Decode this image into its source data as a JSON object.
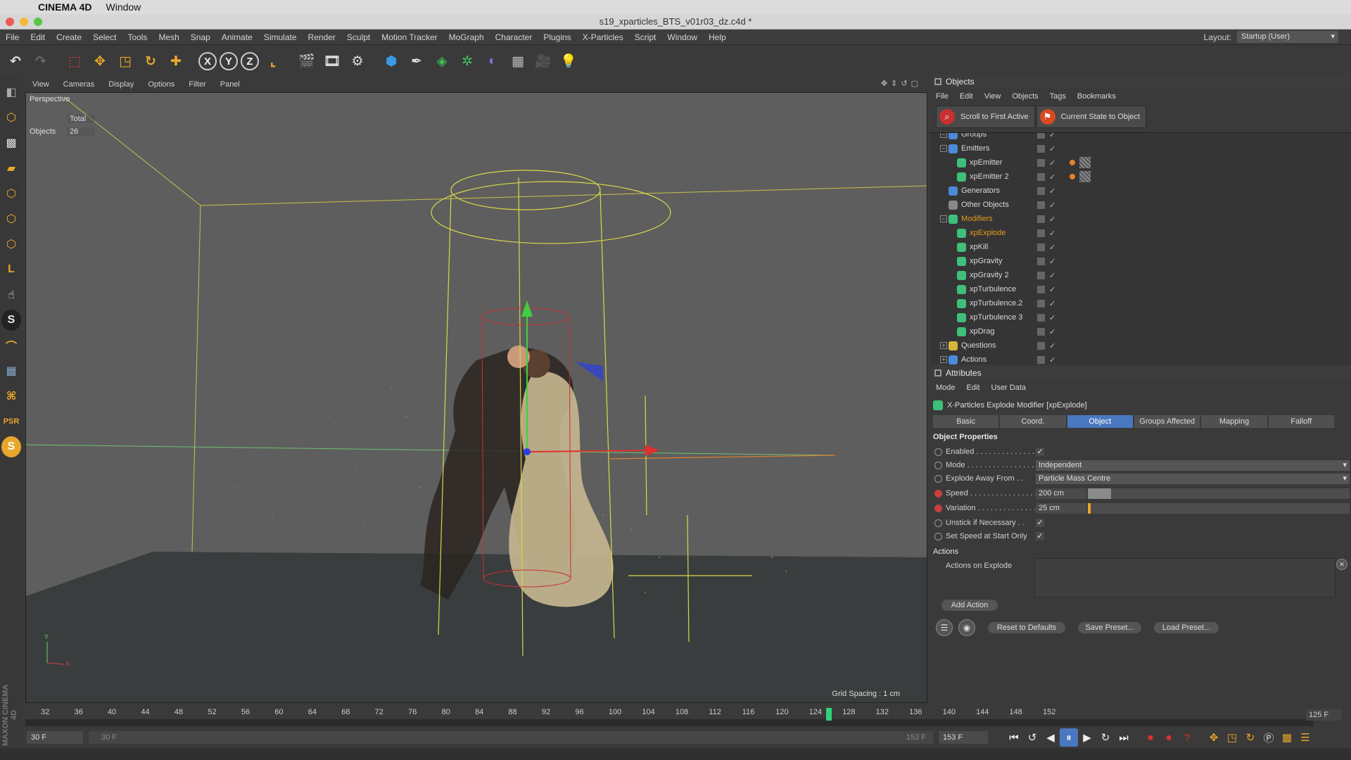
{
  "mac_menu": {
    "app": "CINEMA 4D",
    "items": [
      "Window"
    ]
  },
  "window": {
    "title": "s19_xparticles_BTS_v01r03_dz.c4d *"
  },
  "menu": [
    "File",
    "Edit",
    "Create",
    "Select",
    "Tools",
    "Mesh",
    "Snap",
    "Animate",
    "Simulate",
    "Render",
    "Sculpt",
    "Motion Tracker",
    "MoGraph",
    "Character",
    "Plugins",
    "X-Particles",
    "Script",
    "Window",
    "Help"
  ],
  "layout": {
    "label": "Layout:",
    "value": "Startup (User)"
  },
  "toolbar": {
    "x_label": "X",
    "y_label": "Y",
    "z_label": "Z"
  },
  "viewport": {
    "menu": [
      "View",
      "Cameras",
      "Display",
      "Options",
      "Filter",
      "Panel"
    ],
    "label": "Perspective",
    "hud_total": "Total",
    "hud_objects_label": "Objects",
    "hud_objects_value": "26",
    "grid_spacing": "Grid Spacing : 1 cm",
    "axis_y": "Y",
    "axis_x": "X"
  },
  "timeline": {
    "ticks": [
      "32",
      "36",
      "40",
      "44",
      "48",
      "52",
      "56",
      "60",
      "64",
      "68",
      "72",
      "76",
      "80",
      "84",
      "88",
      "92",
      "96",
      "100",
      "104",
      "108",
      "112",
      "116",
      "120",
      "124",
      "128",
      "132",
      "136",
      "140",
      "144",
      "148",
      "152"
    ],
    "current_frame": 125,
    "first_frame": 32,
    "last_frame": 152,
    "fps_field": "125 F",
    "start_field": "30 F",
    "range_start": "30 F",
    "range_end": "153 F",
    "end_field": "153 F"
  },
  "objects_panel": {
    "title": "Objects",
    "menu": [
      "File",
      "Edit",
      "View",
      "Objects",
      "Tags",
      "Bookmarks"
    ],
    "btn_scroll": "Scroll to First Active",
    "btn_state": "Current State to Object",
    "rows": [
      {
        "name": "Groups",
        "level": 0,
        "expand": "⊟",
        "color": "#4b8bd8"
      },
      {
        "name": "Emitters",
        "level": 0,
        "expand": "⊟",
        "color": "#4b8bd8"
      },
      {
        "name": "xpEmitter",
        "level": 1,
        "expand": "",
        "color": "#3fbf7a"
      },
      {
        "name": "xpEmitter 2",
        "level": 1,
        "expand": "",
        "color": "#3fbf7a"
      },
      {
        "name": "Generators",
        "level": 0,
        "expand": "",
        "color": "#4b8bd8"
      },
      {
        "name": "Other Objects",
        "level": 0,
        "expand": "",
        "color": "#888888"
      },
      {
        "name": "Modifiers",
        "level": 0,
        "expand": "⊟",
        "color": "#3fbf7a"
      },
      {
        "name": "xpExplode",
        "level": 1,
        "expand": "",
        "color": "#3fbf7a"
      },
      {
        "name": "xpKill",
        "level": 1,
        "expand": "",
        "color": "#3fbf7a"
      },
      {
        "name": "xpGravity",
        "level": 1,
        "expand": "",
        "color": "#3fbf7a"
      },
      {
        "name": "xpGravity 2",
        "level": 1,
        "expand": "",
        "color": "#3fbf7a"
      },
      {
        "name": "xpTurbulence",
        "level": 1,
        "expand": "",
        "color": "#3fbf7a"
      },
      {
        "name": "xpTurbulence.2",
        "level": 1,
        "expand": "",
        "color": "#3fbf7a"
      },
      {
        "name": "xpTurbulence 3",
        "level": 1,
        "expand": "",
        "color": "#3fbf7a"
      },
      {
        "name": "xpDrag",
        "level": 1,
        "expand": "",
        "color": "#3fbf7a"
      },
      {
        "name": "Questions",
        "level": 0,
        "expand": "⊞",
        "color": "#d8b43a"
      },
      {
        "name": "Actions",
        "level": 0,
        "expand": "⊞",
        "color": "#4b8bd8"
      }
    ],
    "highlight_color": "#e89a1e"
  },
  "attributes": {
    "title": "Attributes",
    "menu": [
      "Mode",
      "Edit",
      "User Data"
    ],
    "object_title": "X-Particles Explode Modifier [xpExplode]",
    "tabs": [
      "Basic",
      "Coord.",
      "Object",
      "Groups Affected",
      "Mapping",
      "Falloff"
    ],
    "active_tab": "Object",
    "section_props": "Object Properties",
    "enabled_label": "Enabled . . . . . . . . . . . . . .",
    "mode_label": "Mode . . . . . . . . . . . . . . . . .",
    "mode_value": "Independent",
    "explode_label": "Explode Away From . .",
    "explode_value": "Particle Mass Centre",
    "speed_label": "Speed . . . . . . . . . . . . . . . .",
    "speed_value": "200 cm",
    "speed_fill": 0.09,
    "variation_label": "Variation . . . . . . . . . . . . . .",
    "variation_value": "25 cm",
    "variation_fill": 0.01,
    "unstick_label": "Unstick if Necessary . .",
    "setspeed_label": "Set Speed at Start Only",
    "check": "✓",
    "section_actions": "Actions",
    "actions_on_explode": "Actions on Explode",
    "add_action": "Add Action",
    "reset_defaults": "Reset to Defaults",
    "save_preset": "Save Preset...",
    "load_preset": "Load Preset..."
  },
  "colors": {
    "accent_blue": "#4a78c0",
    "viewport_bg": "#5e5e5e",
    "timeline_cursor": "#2fd47a"
  }
}
